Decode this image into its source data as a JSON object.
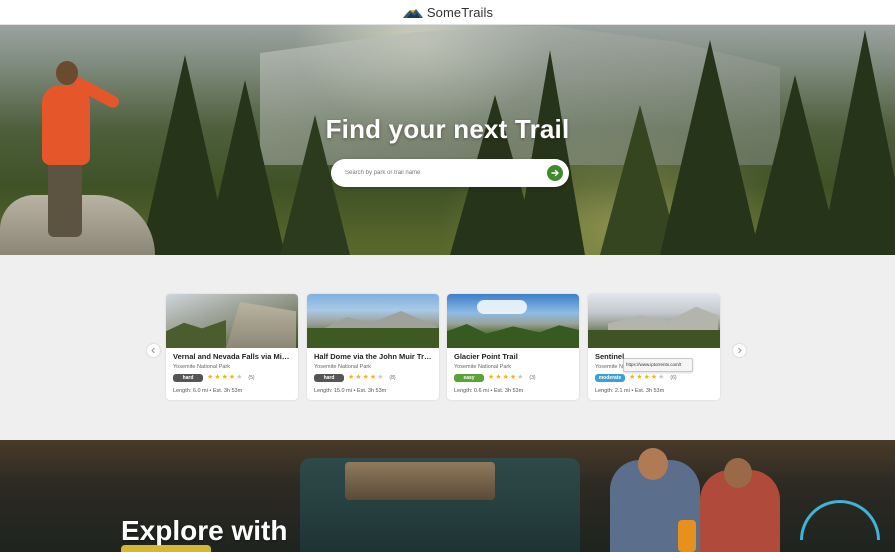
{
  "brand": {
    "name": "SomeTrails"
  },
  "hero": {
    "title": "Find your next Trail",
    "search_placeholder": "Search by park or trail name"
  },
  "cards": [
    {
      "title": "Vernal and Nevada Falls via Mis...",
      "park": "Yosemite National Park",
      "difficulty": "hard",
      "rating": 4,
      "reviews": "(5)",
      "length": "Length: 6.0 mi • Est. 3h 53m"
    },
    {
      "title": "Half Dome via the John Muir Tra...",
      "park": "Yosemite National Park",
      "difficulty": "hard",
      "rating": 4,
      "reviews": "(8)",
      "length": "Length: 15.0 mi • Est. 3h 53m"
    },
    {
      "title": "Glacier Point Trail",
      "park": "Yosemite National Park",
      "difficulty": "easy",
      "rating": 4,
      "reviews": "(3)",
      "length": "Length: 0.6 mi • Est. 3h 53m"
    },
    {
      "title": "Sentinel",
      "park": "Yosemite N",
      "difficulty": "moderate",
      "rating": 4,
      "reviews": "(6)",
      "length": "Length: 2.1 mi • Est. 3h 53m"
    }
  ],
  "tooltip": {
    "text": "https://www.iptorrents.com/t"
  },
  "explore": {
    "title": "Explore with"
  },
  "colors": {
    "accent_green": "#3f8a2c",
    "easy": "#5aa334",
    "hard": "#555555",
    "moderate": "#3aa0d8",
    "star": "#f0b323"
  },
  "icons": {
    "search_go": "arrow-right-icon",
    "prev": "chevron-left-icon",
    "next": "chevron-right-icon"
  }
}
